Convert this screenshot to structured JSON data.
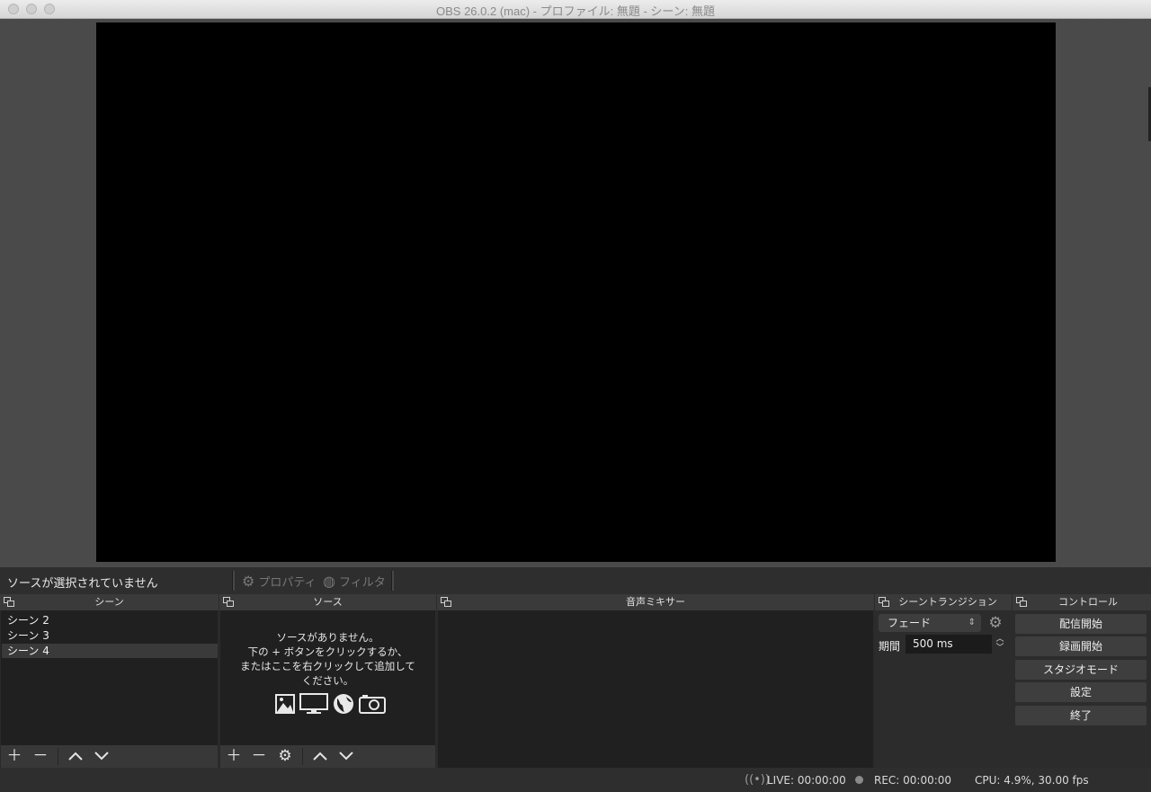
{
  "window": {
    "title": "OBS 26.0.2 (mac) - プロファイル: 無題 - シーン: 無題"
  },
  "source_toolbar": {
    "no_selection": "ソースが選択されていません",
    "properties_label": "プロパティ",
    "filters_label": "フィルタ"
  },
  "docks": {
    "scenes": {
      "title": "シーン",
      "items": [
        {
          "label": "シーン 2"
        },
        {
          "label": "シーン 3"
        },
        {
          "label": "シーン 4",
          "selected": true
        }
      ]
    },
    "sources": {
      "title": "ソース",
      "empty_line1": "ソースがありません。",
      "empty_line2": "下の + ボタンをクリックするか、",
      "empty_line3": "またはここを右クリックして追加して",
      "empty_line4": "ください。",
      "icons": [
        "image-icon",
        "display-icon",
        "globe-icon",
        "camera-icon"
      ]
    },
    "mixer": {
      "title": "音声ミキサー"
    },
    "transitions": {
      "title": "シーントランジション",
      "selected": "フェード",
      "duration_label": "期間",
      "duration_value": "500 ms"
    },
    "controls": {
      "title": "コントロール",
      "start_streaming": "配信開始",
      "start_recording": "録画開始",
      "studio_mode": "スタジオモード",
      "settings": "設定",
      "exit": "終了"
    }
  },
  "status": {
    "live": "LIVE: 00:00:00",
    "rec": "REC: 00:00:00",
    "cpu": "CPU: 4.9%, 30.00 fps"
  }
}
